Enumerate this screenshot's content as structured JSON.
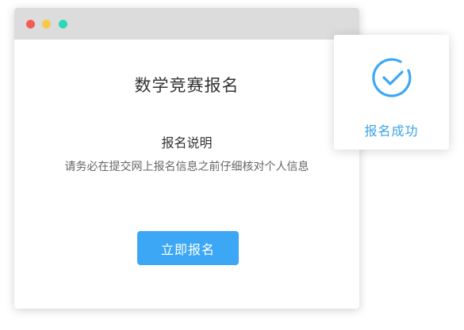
{
  "colors": {
    "dot_red": "#f45b54",
    "dot_yellow": "#f7c948",
    "dot_green": "#2bd9b6",
    "accent": "#3ca8f5",
    "success_text": "#3aa3e8"
  },
  "window": {
    "title": "数学竞赛报名",
    "section_heading": "报名说明",
    "section_desc": "请务必在提交网上报名信息之前仔细核对个人信息",
    "button_label": "立即报名"
  },
  "success_card": {
    "icon": "check-circle-icon",
    "label": "报名成功"
  }
}
